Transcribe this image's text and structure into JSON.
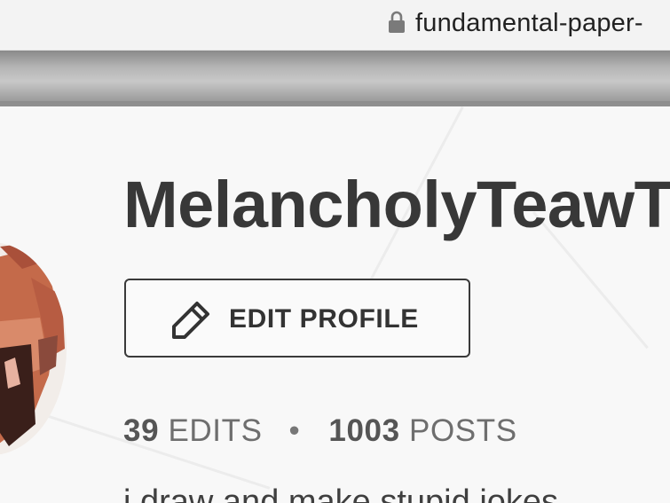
{
  "browser": {
    "url": "fundamental-paper-",
    "lock_icon": "lock-icon"
  },
  "profile": {
    "username": "MelancholyTeawT",
    "edit_button_label": "EDIT PROFILE",
    "edit_icon": "pencil-icon",
    "stats": {
      "edits_count": "39",
      "edits_label": "EDITS",
      "separator": "•",
      "posts_count": "1003",
      "posts_label": "POSTS"
    },
    "bio": "i draw and make stupid jokes"
  },
  "colors": {
    "text_primary": "#383838",
    "text_secondary": "#6e6e6e",
    "banner_grey": "#b5b5b5",
    "avatar_main": "#c46a4a",
    "avatar_dark": "#3a1f1a"
  }
}
